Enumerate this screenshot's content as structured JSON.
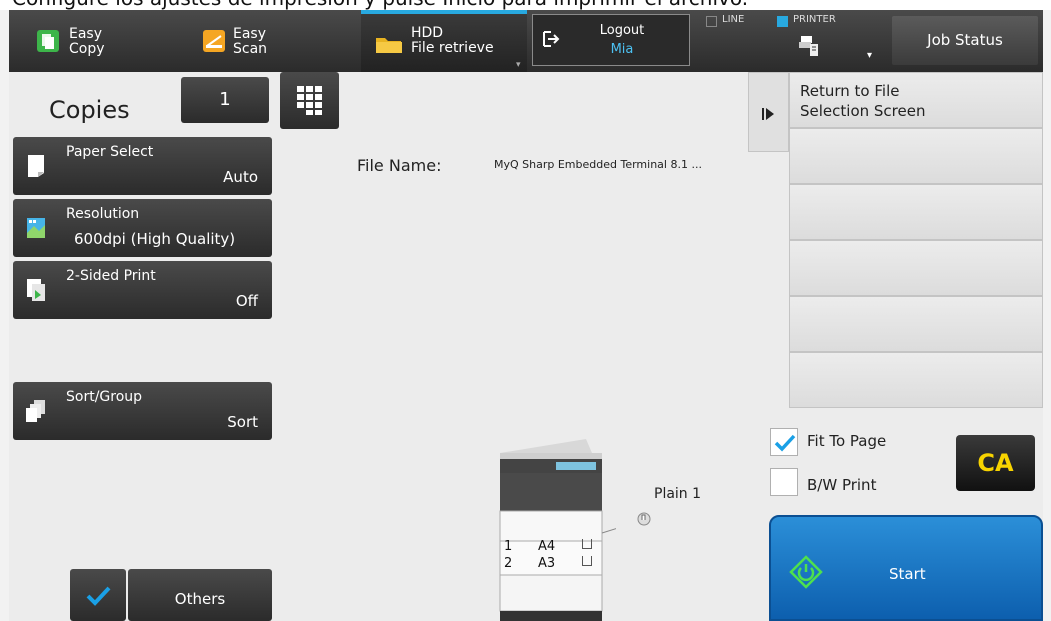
{
  "caption": {
    "text": "Configure los ajustes de impresión y pulse Inicio para imprimir el archivo."
  },
  "topbar": {
    "easy_copy": "Easy\nCopy",
    "easy_scan": "Easy\nScan",
    "hdd_retrieve": "HDD\nFile retrieve",
    "logout_label": "Logout",
    "logout_user": "Mia",
    "line_label": "LINE",
    "printer_label": "PRINTER",
    "job_status": "Job Status"
  },
  "copies": {
    "label": "Copies",
    "value": "1"
  },
  "functions": [
    {
      "title": "Paper Select",
      "value": "Auto"
    },
    {
      "title": "Resolution",
      "value": "600dpi (High Quality)"
    },
    {
      "title": "2-Sided Print",
      "value": "Off"
    },
    {
      "title": "Sort/Group",
      "value": "Sort"
    }
  ],
  "others_label": "Others",
  "file": {
    "label": "File Name:",
    "name": "MyQ Sharp Embedded Terminal 8.1 ..."
  },
  "right_list": {
    "items": [
      "Return to File\nSelection Screen",
      "",
      "",
      "",
      "",
      ""
    ]
  },
  "options": {
    "fit_to_page": {
      "label": "Fit To Page",
      "checked": true
    },
    "bw_print": {
      "label": "B/W Print",
      "checked": false
    }
  },
  "ca_label": "CA",
  "start_label": "Start",
  "printer": {
    "paper_label": "Plain 1",
    "trays": [
      {
        "num": "1",
        "size": "A4"
      },
      {
        "num": "2",
        "size": "A3"
      }
    ]
  },
  "colors": {
    "accent": "#28a9e0",
    "start_blue": "#1a78c8",
    "ca_yellow": "#f7d300",
    "check_blue": "#1aa0e6"
  }
}
